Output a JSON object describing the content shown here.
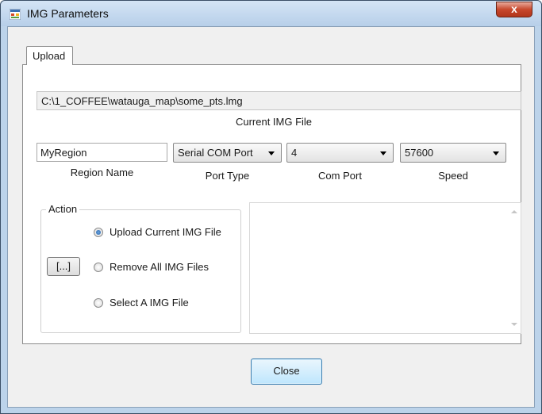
{
  "window": {
    "title": "IMG Parameters",
    "close_glyph": "x"
  },
  "tabs": [
    {
      "label": "Upload",
      "active": true
    }
  ],
  "file": {
    "current_path": "C:\\1_COFFEE\\watauga_map\\some_pts.lmg",
    "caption": "Current IMG File"
  },
  "region": {
    "value": "MyRegion",
    "caption": "Region Name"
  },
  "port_type": {
    "selected": "Serial COM Port",
    "caption": "Port Type"
  },
  "com_port": {
    "selected": "4",
    "caption": "Com Port"
  },
  "speed": {
    "selected": "57600",
    "caption": "Speed"
  },
  "action": {
    "legend": "Action",
    "browse_label": "[...]",
    "options": [
      {
        "label": "Upload Current IMG File",
        "checked": true
      },
      {
        "label": "Remove All IMG Files",
        "checked": false
      },
      {
        "label": "Select A IMG File",
        "checked": false
      }
    ]
  },
  "footer": {
    "close_label": "Close"
  },
  "icons": {
    "app": "app-window-icon",
    "select_arrow": "chevron-down-icon",
    "scroll_up": "scroll-up-arrow-icon",
    "scroll_down": "scroll-down-arrow-icon"
  }
}
